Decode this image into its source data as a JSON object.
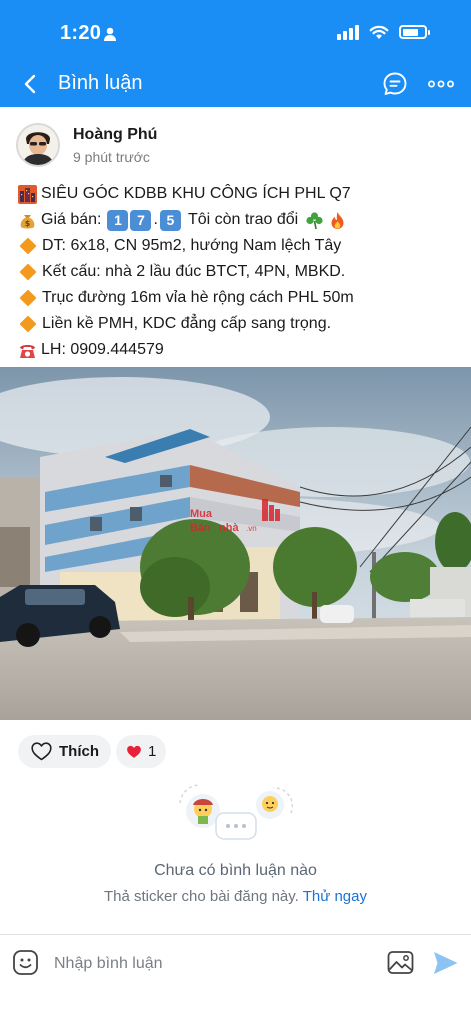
{
  "status_bar": {
    "time": "1:20"
  },
  "nav": {
    "title": "Bình luận"
  },
  "post": {
    "author": "Hoàng Phú",
    "time": "9 phút trước",
    "lines": [
      {
        "icon": "building-icon",
        "text": "SIÊU GÓC KDBB KHU CÔNG ÍCH PHL Q7"
      },
      {
        "icon": "money-bag-icon",
        "text": "Giá bán:",
        "keycaps": [
          "1",
          "7",
          "5"
        ],
        "after": "Tôi còn trao đổi",
        "extra_icons": [
          "shamrock-icon",
          "fire-icon"
        ]
      },
      {
        "icon": "diamond-icon",
        "text": "DT: 6x18, CN 95m2, hướng Nam lệch Tây"
      },
      {
        "icon": "diamond-icon",
        "text": "Kết cấu: nhà 2 lầu đúc BTCT, 4PN, MBKD."
      },
      {
        "icon": "diamond-icon",
        "text": "Trục đường 16m vỉa hè rộng cách PHL 50m"
      },
      {
        "icon": "diamond-icon",
        "text": "Liền kề PMH, KDC đẳng cấp sang trọng."
      },
      {
        "icon": "telephone-icon",
        "text": "LH: 0909.444579"
      }
    ],
    "photo_watermark": [
      "Mua",
      "Bán",
      "nhà",
      ".vn"
    ]
  },
  "reactions": {
    "like_label": "Thích",
    "heart_count": "1"
  },
  "comments": {
    "empty_title": "Chưa có bình luận nào",
    "empty_hint": "Thả sticker cho bài đăng này.",
    "empty_action": "Thử ngay"
  },
  "input": {
    "placeholder": "Nhập bình luận"
  },
  "colors": {
    "header_bg": "#1a8ef5",
    "accent_link": "#1a73d9",
    "diamond": "#f39a1e"
  }
}
